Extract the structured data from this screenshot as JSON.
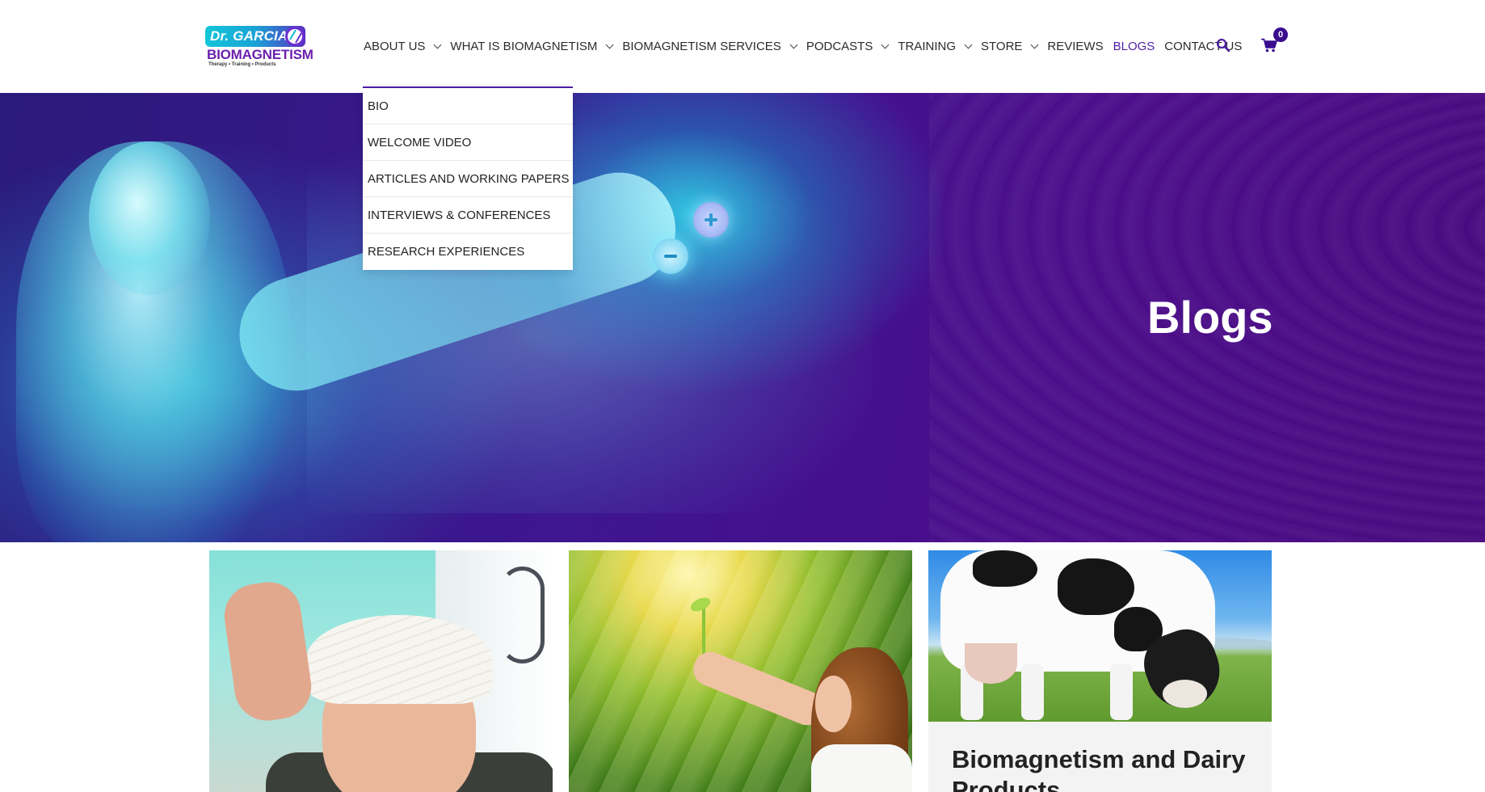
{
  "header": {
    "logo": {
      "dr_text": "Dr. GARCIA",
      "brand_text": "BIOMAGNETISM",
      "tagline": "Therapy • Training • Products"
    },
    "nav": [
      {
        "label": "ABOUT US",
        "has_dropdown": true
      },
      {
        "label": "WHAT IS BIOMAGNETISM",
        "has_dropdown": true
      },
      {
        "label": "BIOMAGNETISM SERVICES",
        "has_dropdown": true
      },
      {
        "label": "PODCASTS",
        "has_dropdown": true
      },
      {
        "label": "TRAINING",
        "has_dropdown": true
      },
      {
        "label": "STORE",
        "has_dropdown": true
      },
      {
        "label": "REVIEWS",
        "has_dropdown": false
      },
      {
        "label": "BLOGS",
        "has_dropdown": false,
        "active": true
      },
      {
        "label": "CONTACT US",
        "has_dropdown": false
      }
    ],
    "search_icon": "search-icon",
    "cart_icon": "shopping-cart-icon",
    "cart_count": "0"
  },
  "dropdown": {
    "items": [
      {
        "label": "BIO"
      },
      {
        "label": "WELCOME VIDEO"
      },
      {
        "label": "ARTICLES AND WORKING PAPERS"
      },
      {
        "label": "INTERVIEWS & CONFERENCES"
      },
      {
        "label": "RESEARCH EXPERIENCES"
      }
    ]
  },
  "hero": {
    "title": "Blogs"
  },
  "posts": [
    {
      "image": "head-bandage-photo",
      "title": ""
    },
    {
      "image": "girl-holding-sprout-photo",
      "title": ""
    },
    {
      "image": "grazing-cow-photo",
      "title": "Biomagnetism and Dairy Products"
    }
  ],
  "colors": {
    "accent": "#4b1fa3",
    "cart_badge": "#3a0d8f",
    "hero_purple": "#48097e",
    "hero_cyan": "#28e6f0"
  }
}
